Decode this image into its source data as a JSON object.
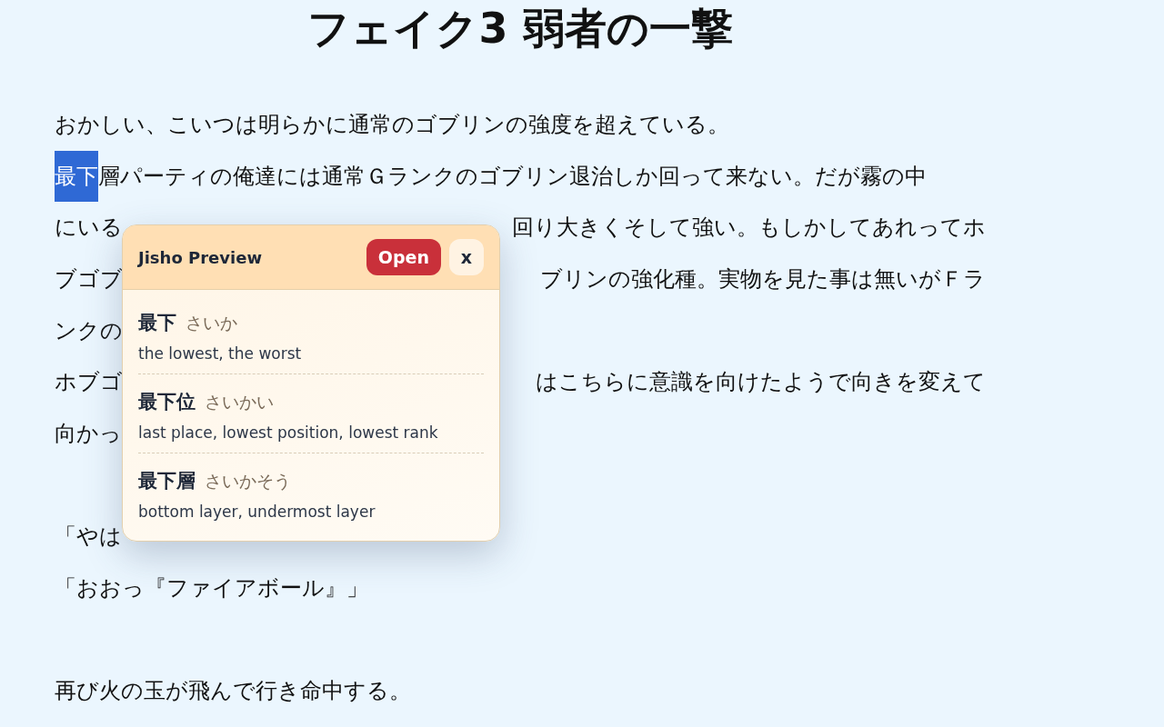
{
  "title": "フェイク3 弱者の一撃",
  "lines": [
    {
      "kind": "text",
      "start": [
        {
          "text": "おかしい、こいつは明らかに通常のゴブリンの強度を超えている。",
          "highlighted": false
        }
      ]
    },
    {
      "kind": "text",
      "start": [
        {
          "text": "最下",
          "highlighted": true
        },
        {
          "text": "層パーティの俺達には通常Ｇランクのゴブリン退治しか回って来ない。だが霧の中",
          "highlighted": false
        }
      ]
    },
    {
      "kind": "text",
      "start": [
        {
          "text": "にいる",
          "highlighted": false
        }
      ],
      "end": "回り大きくそして強い。もしかしてあれってホ"
    },
    {
      "kind": "text",
      "start": [
        {
          "text": "ブゴブ",
          "highlighted": false
        }
      ],
      "end": "ブリンの強化種。実物を見た事は無いがＦラ"
    },
    {
      "kind": "text",
      "start": [
        {
          "text": "ンクの",
          "highlighted": false
        }
      ]
    },
    {
      "kind": "text",
      "start": [
        {
          "text": "ホブゴ",
          "highlighted": false
        }
      ],
      "end": "はこちらに意識を向けたようで向きを変えて"
    },
    {
      "kind": "text",
      "start": [
        {
          "text": "向かっ",
          "highlighted": false
        }
      ]
    },
    {
      "kind": "blank"
    },
    {
      "kind": "text",
      "start": [
        {
          "text": "「やは",
          "highlighted": false
        }
      ]
    },
    {
      "kind": "text",
      "start": [
        {
          "text": "「おおっ『ファイアボール』」",
          "highlighted": false
        }
      ]
    },
    {
      "kind": "blank"
    },
    {
      "kind": "text",
      "start": [
        {
          "text": "再び火の玉が飛んで行き命中する。",
          "highlighted": false
        }
      ]
    }
  ],
  "popup": {
    "title": "Jisho Preview",
    "open_button": "Open",
    "close_button": "x",
    "entries": [
      {
        "word": "最下",
        "reading": "さいか",
        "meaning": "the lowest, the worst"
      },
      {
        "word": "最下位",
        "reading": "さいかい",
        "meaning": "last place, lowest position, lowest rank"
      },
      {
        "word": "最下層",
        "reading": "さいかそう",
        "meaning": "bottom layer, undermost layer"
      }
    ]
  }
}
